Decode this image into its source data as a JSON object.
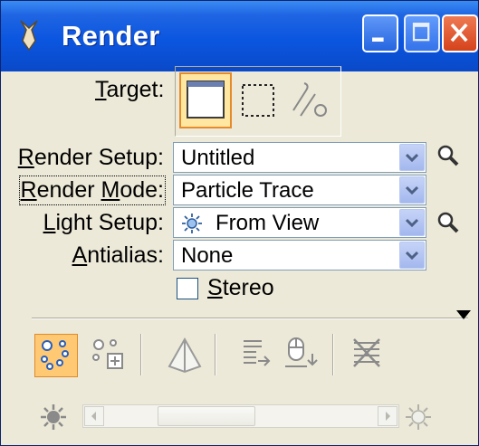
{
  "window": {
    "title": "Render",
    "controls": {
      "minimize": "minimize",
      "maximize": "maximize",
      "close": "close"
    }
  },
  "target": {
    "label_pre": "",
    "label_u": "T",
    "label_post": "arget:",
    "options": [
      "view-icon",
      "fence-icon",
      "element-icon"
    ],
    "selected": "view-icon"
  },
  "render_setup": {
    "label_u": "R",
    "label_post": "ender Setup:",
    "value": "Untitled"
  },
  "render_mode": {
    "label_u": "R",
    "label_mid": "ender ",
    "label_u2": "M",
    "label_post": "ode:",
    "value": "Particle Trace"
  },
  "light_setup": {
    "label_u": "L",
    "label_post": "ight Setup:",
    "value": "From View"
  },
  "antialias": {
    "label_u": "A",
    "label_post": "ntialias:",
    "value": "None"
  },
  "stereo": {
    "label_u": "S",
    "label_post": "tereo",
    "checked": false
  },
  "toolbar": {
    "tools": [
      "render-icon",
      "render-settings-icon",
      "pyramid-icon",
      "save-image-icon",
      "mouse-save-icon",
      "cancel-render-icon"
    ],
    "selected": "render-icon"
  },
  "brightness": {
    "value": 0.3,
    "icons": [
      "dim-sun-icon",
      "bright-sun-icon"
    ]
  },
  "colors": {
    "accent": "#0b56e0",
    "selected_tool": "#ffc873"
  }
}
